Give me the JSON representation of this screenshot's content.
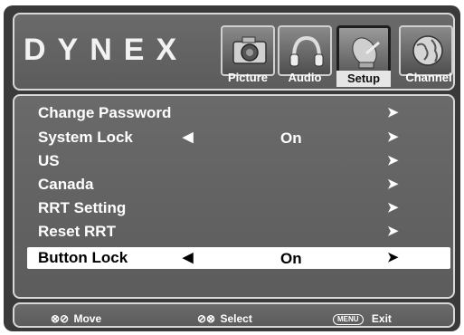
{
  "brand": {
    "logo": "DYNEX"
  },
  "tabs": [
    {
      "label": "Picture",
      "icon": "camera-icon",
      "active": false
    },
    {
      "label": "Audio",
      "icon": "headphones-icon",
      "active": false
    },
    {
      "label": "Setup",
      "icon": "satellite-dish-icon",
      "active": true
    },
    {
      "label": "Channel",
      "icon": "globe-icon",
      "active": false
    }
  ],
  "menu": {
    "items": [
      {
        "label": "Change Password",
        "left_arrow": "",
        "value": "",
        "right_arrow": "➤"
      },
      {
        "label": "System Lock",
        "left_arrow": "◀",
        "value": "On",
        "right_arrow": "➤"
      },
      {
        "label": "US",
        "left_arrow": "",
        "value": "",
        "right_arrow": "➤"
      },
      {
        "label": "Canada",
        "left_arrow": "",
        "value": "",
        "right_arrow": "➤"
      },
      {
        "label": "RRT Setting",
        "left_arrow": "",
        "value": "",
        "right_arrow": "➤"
      },
      {
        "label": "Reset RRT",
        "left_arrow": "",
        "value": "",
        "right_arrow": "➤"
      },
      {
        "label": "Button Lock",
        "left_arrow": "◀",
        "value": "On",
        "right_arrow": "➤",
        "selected": true
      }
    ]
  },
  "footer": {
    "move": {
      "icon": "⊗⊘",
      "label": "Move"
    },
    "select": {
      "icon": "⊘⊗",
      "label": "Select"
    },
    "exit": {
      "key": "MENU",
      "label": "Exit"
    }
  },
  "colors": {
    "panel": "#5c5c5c",
    "border": "#d8d8d8",
    "highlight": "#ffffff",
    "frame": "#3a3a3a"
  }
}
